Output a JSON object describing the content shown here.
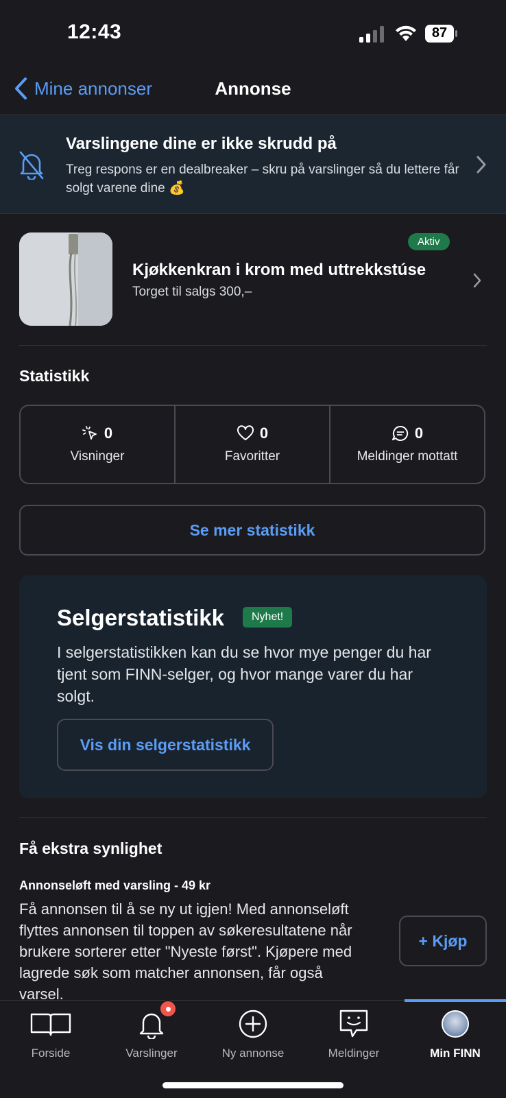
{
  "status_bar": {
    "time": "12:43",
    "battery": "87"
  },
  "nav": {
    "back_label": "Mine annonser",
    "title": "Annonse"
  },
  "banner": {
    "title": "Varslingene dine er ikke skrudd på",
    "text": "Treg respons er en dealbreaker – skru på varslinger så du lettere får solgt varene dine 💰"
  },
  "listing": {
    "status": "Aktiv",
    "title": "Kjøkkenkran i krom med uttrekkstúse",
    "subtitle": "Torget til salgs 300,–"
  },
  "stats": {
    "heading": "Statistikk",
    "items": [
      {
        "icon": "cursor-click-icon",
        "value": "0",
        "label": "Visninger"
      },
      {
        "icon": "heart-icon",
        "value": "0",
        "label": "Favoritter"
      },
      {
        "icon": "chat-bubble-icon",
        "value": "0",
        "label": "Meldinger mottatt"
      }
    ],
    "more_button": "Se mer statistikk"
  },
  "seller_stats": {
    "title": "Selgerstatistikk",
    "badge": "Nyhet!",
    "text": "I selgerstatistikken kan du se hvor mye penger du har tjent som FINN-selger, og hvor mange varer du har solgt.",
    "button": "Vis din selgerstatistikk"
  },
  "visibility": {
    "heading": "Få ekstra synlighet",
    "product_title": "Annonseløft med varsling - 49 kr",
    "text": "Få annonsen til å se ny ut igjen! Med annonseløft flyttes annonsen til toppen av søkeresultatene når brukere sorterer etter \"Nyeste først\". Kjøpere med lagrede søk som matcher annonsen, får også varsel.",
    "buy_button": "+ Kjøp"
  },
  "tabbar": {
    "items": [
      {
        "icon": "book-icon",
        "label": "Forside"
      },
      {
        "icon": "bell-icon",
        "label": "Varslinger"
      },
      {
        "icon": "plus-circle-icon",
        "label": "Ny annonse"
      },
      {
        "icon": "message-icon",
        "label": "Meldinger"
      },
      {
        "icon": "avatar",
        "label": "Min FINN"
      }
    ],
    "active": "Min FINN"
  },
  "colors": {
    "accent": "#5b9cf5",
    "badge_green": "#1f7a4b",
    "notification_dot": "#f0554b",
    "background": "#1b1b1f"
  }
}
